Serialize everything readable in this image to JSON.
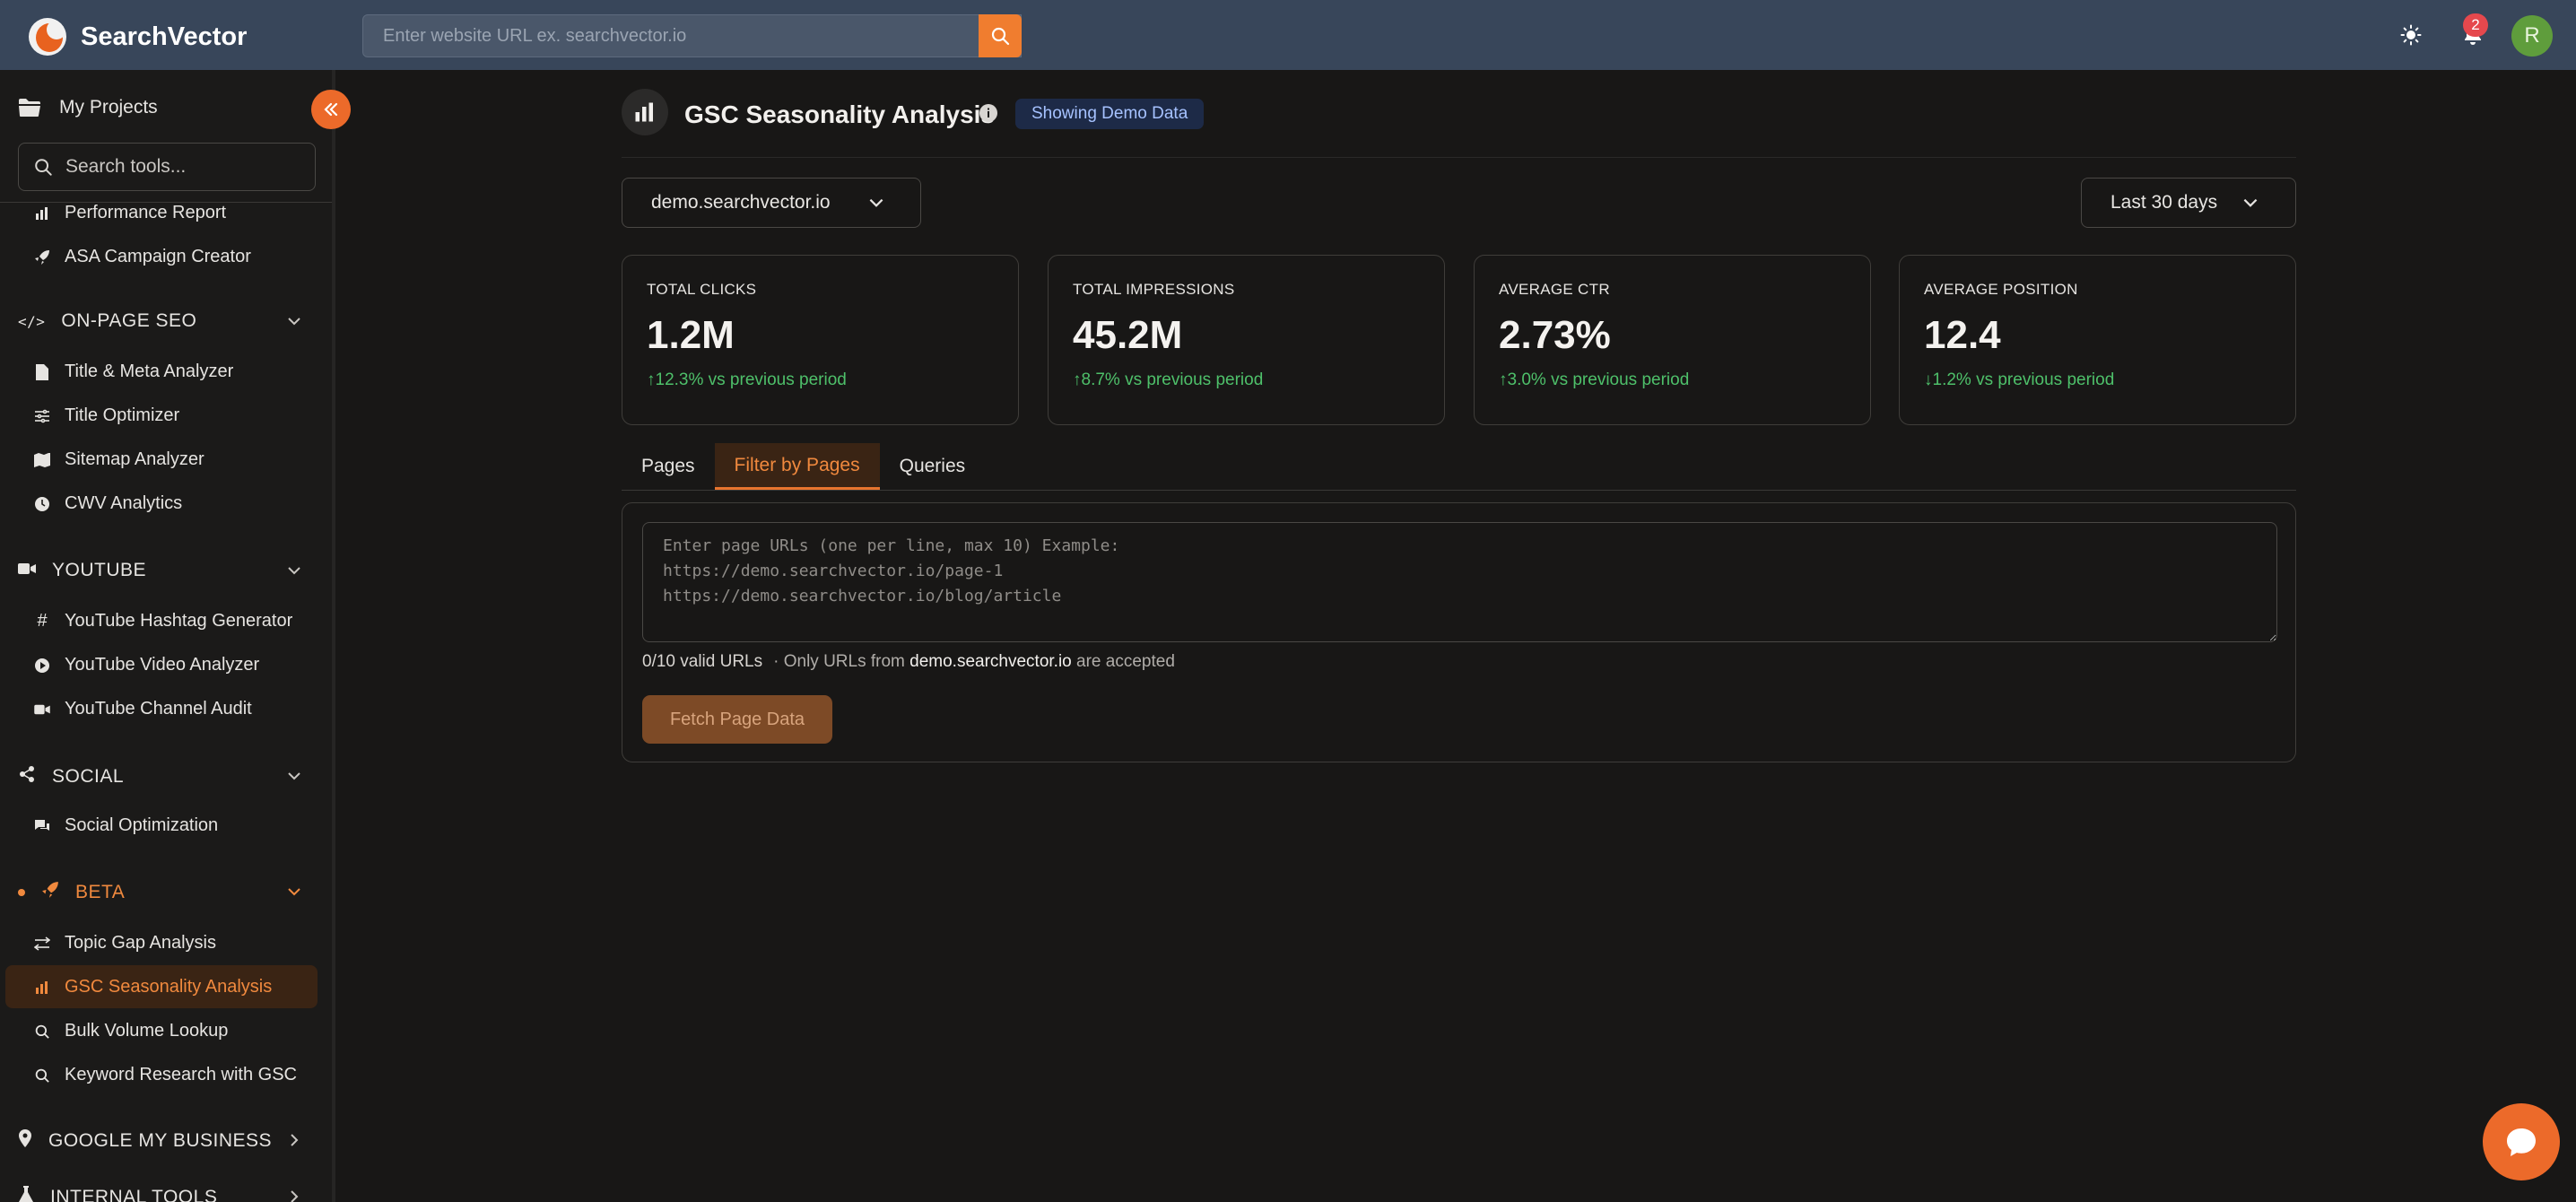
{
  "header": {
    "app_name": "SearchVector",
    "url_placeholder": "Enter website URL ex. searchvector.io",
    "notification_count": "2",
    "avatar_initial": "R"
  },
  "sidebar": {
    "my_projects": "My Projects",
    "search_placeholder": "Search tools...",
    "top_items": [
      {
        "label": "Performance Report",
        "icon": "bar-chart-icon"
      },
      {
        "label": "ASA Campaign Creator",
        "icon": "rocket-icon"
      }
    ],
    "sections": [
      {
        "label": "ON-PAGE SEO",
        "icon": "code-icon",
        "expanded": true,
        "items": [
          "Title & Meta Analyzer",
          "Title Optimizer",
          "Sitemap Analyzer",
          "CWV Analytics"
        ]
      },
      {
        "label": "YOUTUBE",
        "icon": "video-icon",
        "expanded": true,
        "items": [
          "YouTube Hashtag Generator",
          "YouTube Video Analyzer",
          "YouTube Channel Audit"
        ]
      },
      {
        "label": "SOCIAL",
        "icon": "share-icon",
        "expanded": true,
        "items": [
          "Social Optimization"
        ]
      },
      {
        "label": "BETA",
        "icon": "rocket-icon",
        "expanded": true,
        "items": [
          "Topic Gap Analysis",
          "GSC Seasonality Analysis",
          "Bulk Volume Lookup",
          "Keyword Research with GSC"
        ]
      },
      {
        "label": "GOOGLE MY BUSINESS",
        "icon": "location-pin-icon",
        "expanded": false,
        "items": []
      },
      {
        "label": "INTERNAL TOOLS",
        "icon": "flask-icon",
        "expanded": false,
        "items": []
      }
    ],
    "active_item": "GSC Seasonality Analysis"
  },
  "page": {
    "title": "GSC Seasonality Analysis",
    "demo_badge": "Showing Demo Data",
    "site_select": "demo.searchvector.io",
    "range_select": "Last 30 days"
  },
  "metrics": [
    {
      "label": "TOTAL CLICKS",
      "value": "1.2M",
      "delta": "12.3% vs previous period",
      "direction": "up"
    },
    {
      "label": "TOTAL IMPRESSIONS",
      "value": "45.2M",
      "delta": "8.7% vs previous period",
      "direction": "up"
    },
    {
      "label": "AVERAGE CTR",
      "value": "2.73%",
      "delta": "3.0% vs previous period",
      "direction": "up"
    },
    {
      "label": "AVERAGE POSITION",
      "value": "12.4",
      "delta": "1.2% vs previous period",
      "direction": "down"
    }
  ],
  "tabs": [
    {
      "label": "Pages",
      "active": false
    },
    {
      "label": "Filter by Pages",
      "active": true
    },
    {
      "label": "Queries",
      "active": false
    }
  ],
  "filter": {
    "textarea_placeholder": "Enter page URLs (one per line, max 10) Example:\nhttps://demo.searchvector.io/page-1\nhttps://demo.searchvector.io/blog/article",
    "valid_count": "0/10 valid URLs",
    "only_prefix": "· Only URLs from",
    "domain": "demo.searchvector.io",
    "only_suffix": "are accepted",
    "fetch_label": "Fetch Page Data"
  },
  "colors": {
    "accent": "#ec6a2a",
    "header_bg": "#38465a",
    "positive": "#4ec06a"
  }
}
